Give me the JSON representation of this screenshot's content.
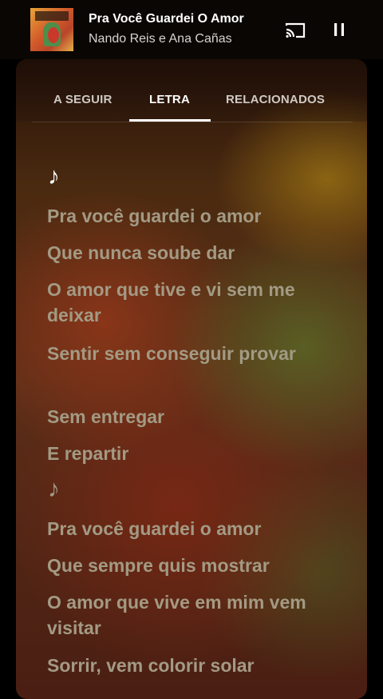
{
  "now_playing": {
    "title": "Pra Você Guardei O Amor",
    "artist": "Nando Reis e Ana Cañas"
  },
  "controls": {
    "cast_icon": "cast-icon",
    "pause_icon": "pause-icon"
  },
  "tabs": [
    {
      "label": "A SEGUIR",
      "active": false
    },
    {
      "label": "LETRA",
      "active": true
    },
    {
      "label": "RELACIONADOS",
      "active": false
    }
  ],
  "lyrics": [
    {
      "type": "note",
      "text": "♪",
      "color": "#ffffff"
    },
    {
      "type": "line",
      "text": "Pra você guardei o amor"
    },
    {
      "type": "line",
      "text": "Que nunca soube dar"
    },
    {
      "type": "line",
      "text": "O amor que tive e vi sem me deixar"
    },
    {
      "type": "line",
      "text": "Sentir sem conseguir provar"
    },
    {
      "type": "line",
      "text": "Sem entregar"
    },
    {
      "type": "line",
      "text": "E repartir"
    },
    {
      "type": "note",
      "text": "♪",
      "color": "#a39a84"
    },
    {
      "type": "line",
      "text": "Pra você guardei o amor"
    },
    {
      "type": "line",
      "text": "Que sempre quis mostrar"
    },
    {
      "type": "line",
      "text": "O amor que vive em mim vem visitar"
    },
    {
      "type": "line",
      "text": "Sorrir, vem colorir solar"
    }
  ],
  "colors": {
    "lyric_inactive": "#a39a84",
    "lyric_active_note": "#ffffff",
    "tab_active": "#ffffff",
    "tab_inactive": "#cfc9c4"
  }
}
